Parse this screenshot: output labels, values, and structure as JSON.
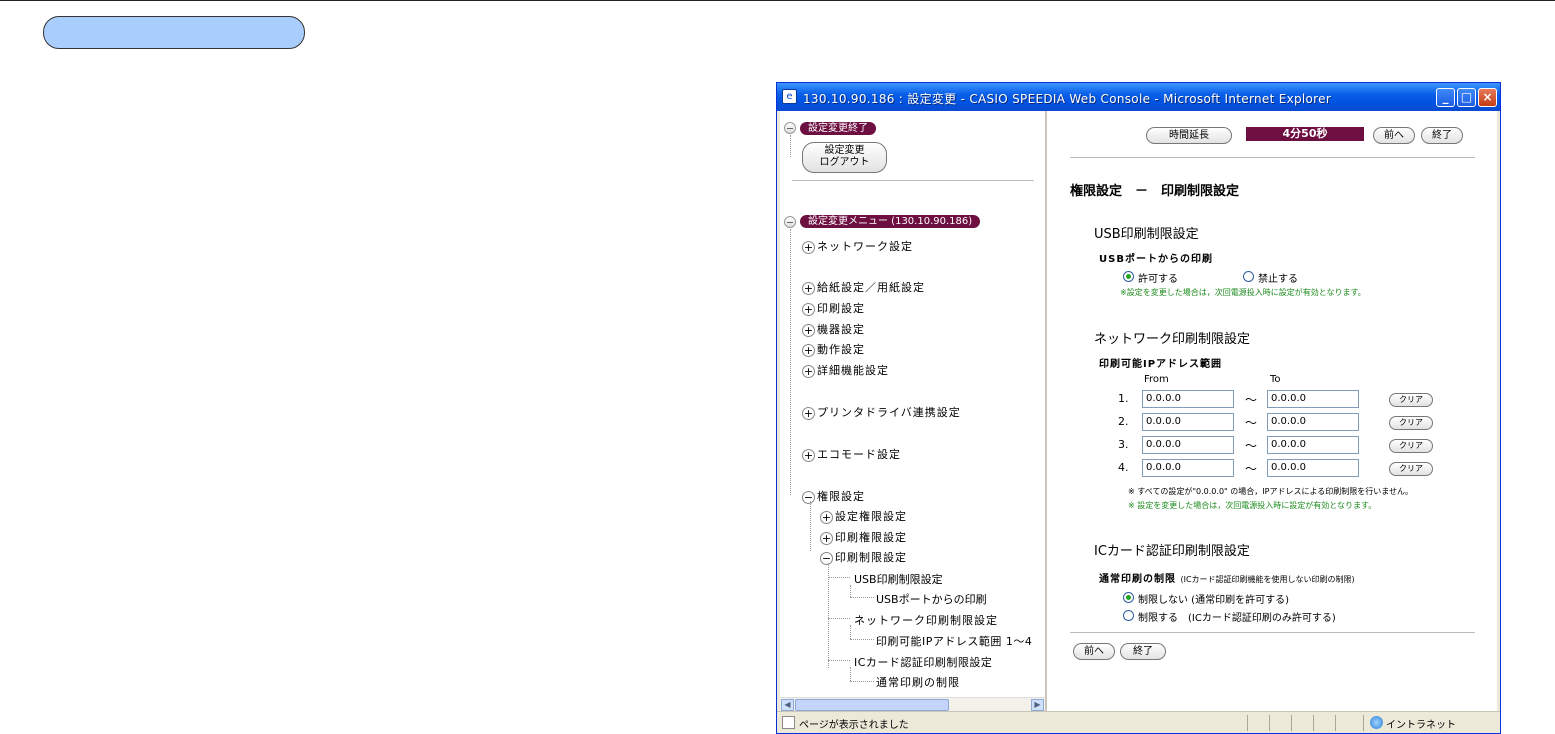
{
  "window": {
    "title": "130.10.90.186 : 設定変更 - CASIO SPEEDIA Web Console - Microsoft Internet Explorer",
    "minimize": "_",
    "maximize": "□",
    "close": "×"
  },
  "leftpane": {
    "exit_header": "設定変更終了",
    "logout_line1": "設定変更",
    "logout_line2": "ログアウト",
    "menu_header": "設定変更メニュー (130.10.90.186)",
    "items": [
      {
        "label": "ネットワーク設定",
        "sign": "+"
      },
      {
        "label": "給紙設定／用紙設定",
        "sign": "+"
      },
      {
        "label": "印刷設定",
        "sign": "+"
      },
      {
        "label": "機器設定",
        "sign": "+"
      },
      {
        "label": "動作設定",
        "sign": "+"
      },
      {
        "label": "詳細機能設定",
        "sign": "+"
      },
      {
        "label": "プリンタドライバ連携設定",
        "sign": "+"
      },
      {
        "label": "エコモード設定",
        "sign": "+"
      },
      {
        "label": "権限設定",
        "sign": "−"
      }
    ],
    "sub_items": [
      {
        "label": "設定権限設定",
        "sign": "+"
      },
      {
        "label": "印刷権限設定",
        "sign": "+"
      },
      {
        "label": "印刷制限設定",
        "sign": "−"
      }
    ],
    "leaf_items": [
      "USB印刷制限設定",
      "USBポートからの印刷",
      "ネットワーク印刷制限設定",
      "印刷可能IPアドレス範囲 1〜4",
      "ICカード認証印刷制限設定",
      "通常印刷の制限"
    ]
  },
  "toolbar": {
    "extend_button": "時間延長",
    "timer": "4分50秒",
    "prev_button": "前へ",
    "end_button": "終了"
  },
  "content": {
    "page_title": "権限設定　－　印刷制限設定",
    "usb": {
      "section_title": "USB印刷制限設定",
      "label": "USBポートからの印刷",
      "option_allow": "許可する",
      "option_deny": "禁止する",
      "selected": "allow",
      "note": "※設定を変更した場合は，次回電源投入時に設定が有効となります。"
    },
    "network": {
      "section_title": "ネットワーク印刷制限設定",
      "label": "印刷可能IPアドレス範囲",
      "col_from": "From",
      "col_to": "To",
      "tilde": "～",
      "clear_label": "クリア",
      "rows": [
        {
          "num": "1.",
          "from": "0.0.0.0",
          "to": "0.0.0.0"
        },
        {
          "num": "2.",
          "from": "0.0.0.0",
          "to": "0.0.0.0"
        },
        {
          "num": "3.",
          "from": "0.0.0.0",
          "to": "0.0.0.0"
        },
        {
          "num": "4.",
          "from": "0.0.0.0",
          "to": "0.0.0.0"
        }
      ],
      "note1": "※ すべての設定が\"0.0.0.0\" の場合，IPアドレスによる印刷制限を行いません。",
      "note2": "※ 設定を変更した場合は，次回電源投入時に設定が有効となります。"
    },
    "iccard": {
      "section_title": "ICカード認証印刷制限設定",
      "label": "通常印刷の制限",
      "label_sub": "(ICカード認証印刷機能を使用しない印刷の制限)",
      "option_none": "制限しない (通常印刷を許可する)",
      "option_limit": "制限する　(ICカード認証印刷のみ許可する)",
      "selected": "none"
    },
    "footer_prev": "前へ",
    "footer_end": "終了"
  },
  "statusbar": {
    "text": "ページが表示されました",
    "zone": "イントラネット"
  }
}
